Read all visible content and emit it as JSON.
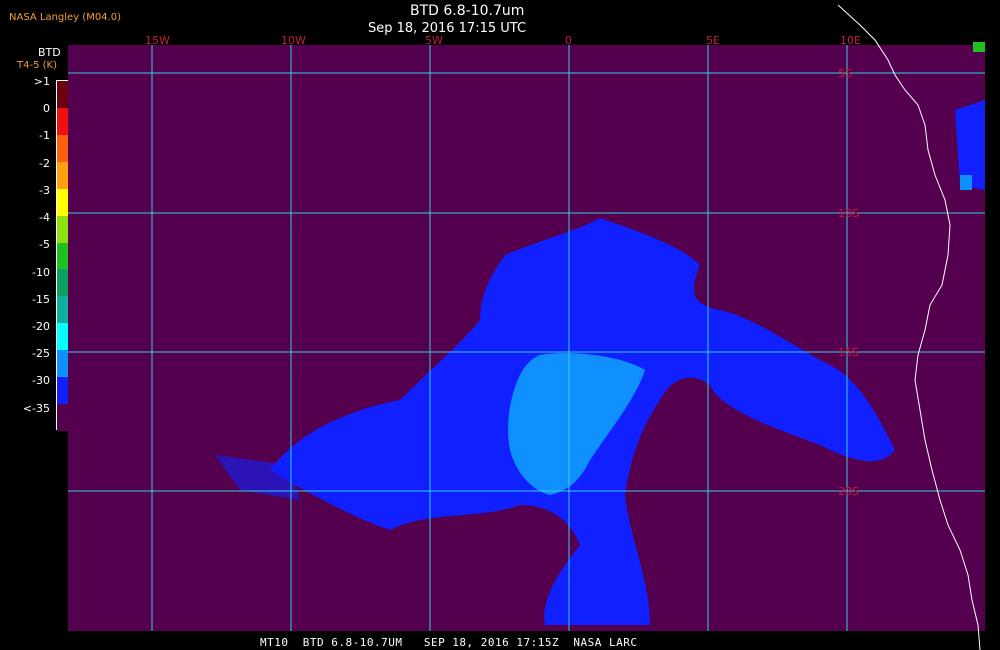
{
  "header": {
    "credit": "NASA Langley (M04.0)",
    "title": "BTD 6.8-10.7um",
    "subtitle": "Sep 18, 2016 17:15 UTC"
  },
  "legend": {
    "title": "BTD",
    "units": "T4-5 (K)",
    "entries": [
      {
        "label": ">1",
        "color": "#6b0010"
      },
      {
        "label": "0",
        "color": "#f01010"
      },
      {
        "label": "-1",
        "color": "#ff6010"
      },
      {
        "label": "-2",
        "color": "#ffa010"
      },
      {
        "label": "-3",
        "color": "#ffff00"
      },
      {
        "label": "-4",
        "color": "#90e010"
      },
      {
        "label": "-5",
        "color": "#20c020"
      },
      {
        "label": "-10",
        "color": "#10a060"
      },
      {
        "label": "-15",
        "color": "#10b0a0"
      },
      {
        "label": "-20",
        "color": "#00ffff"
      },
      {
        "label": "-25",
        "color": "#1090ff"
      },
      {
        "label": "-30",
        "color": "#1020ff"
      },
      {
        "label": "<-35",
        "color": "#55004f"
      }
    ]
  },
  "map": {
    "background_color": "#55004f",
    "grid_color": "#30d0e0",
    "coast_color": "#ffffff",
    "lon_labels": [
      "15W",
      "10W",
      "5W",
      "0",
      "5E",
      "10E"
    ],
    "lat_labels": [
      "5S",
      "10S",
      "15S",
      "20S"
    ],
    "label_color": "#c02040"
  },
  "footer": {
    "text": "MT10  BTD 6.8-10.7UM   SEP 18, 2016 17:15Z  NASA LARC"
  }
}
